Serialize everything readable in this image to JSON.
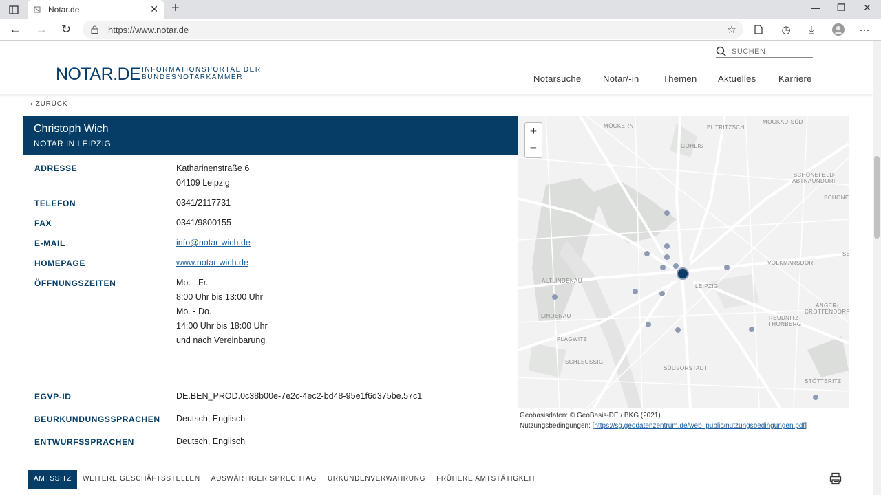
{
  "browser": {
    "tab_title": "Notar.de",
    "url": "https://www.notar.de"
  },
  "site": {
    "logo": "NOTAR.DE",
    "logo_sub_line1": "INFORMATIONSPORTAL DER",
    "logo_sub_line2": "BUNDESNOTARKAMMER",
    "search_placeholder": "SUCHEN",
    "nav": [
      "Notarsuche",
      "Notar/-in",
      "Themen",
      "Aktuelles",
      "Karriere"
    ],
    "back_label": "ZURÜCK"
  },
  "notary": {
    "name": "Christoph Wich",
    "role": "NOTAR IN LEIPZIG",
    "fields": {
      "address_label": "ADRESSE",
      "address_line1": "Katharinenstraße 6",
      "address_line2": "04109 Leipzig",
      "phone_label": "TELEFON",
      "phone": "0341/2117731",
      "fax_label": "FAX",
      "fax": "0341/9800155",
      "email_label": "E-MAIL",
      "email": "info@notar-wich.de",
      "homepage_label": "HOMEPAGE",
      "homepage": "www.notar-wich.de",
      "hours_label": "ÖFFNUNGSZEITEN",
      "hours": [
        "Mo. - Fr.",
        "8:00 Uhr bis 13:00 Uhr",
        "Mo. - Do.",
        "14:00 Uhr bis 18:00 Uhr",
        "und nach Vereinbarung"
      ],
      "egvp_label": "EGVP-ID",
      "egvp": "DE.BEN_PROD.0c38b00e-7e2c-4ec2-bd48-95e1f6d375be.57c1",
      "languages_label": "BEURKUNDUNGSSPRACHEN",
      "languages": "Deutsch, Englisch",
      "draft_languages_label": "ENTWURFSSPRACHEN",
      "draft_languages": "Deutsch, Englisch"
    }
  },
  "map": {
    "zoom_in": "+",
    "zoom_out": "−",
    "places": {
      "moeckern": "MÖCKERN",
      "eutritzsch": "EUTRITZSCH",
      "mockau": "MOCKAU-SÜD",
      "gohlis": "GOHLIS",
      "schoenefeld_1": "SCHÖNEFELD-",
      "schoenefeld_2": "ABTNAUNDORF",
      "schoene": "SCHÖNE",
      "volkmarsdorf": "VOLKMARSDORF",
      "se": "SE",
      "altlindenau": "ALTLINDENAU",
      "leipzig": "LEIPZIG",
      "lindenau": "LINDENAU",
      "anger_1": "ANGER-",
      "anger_2": "CROTTENDORF",
      "reudnitz_1": "REUDNITZ-",
      "reudnitz_2": "THONBERG",
      "plagwitz": "PLAGWITZ",
      "schleussig": "SCHLEUSSIG",
      "suedvorstadt": "SÜDVORSTADT",
      "stoetteritz": "STÖTTERITZ"
    },
    "attribution_line1": "Geobasisdaten: © GeoBasis-DE / BKG (2021)",
    "attribution_prefix": "Nutzungsbedingungen: [",
    "attribution_link": "https://sg.geodatenzentrum.de/web_public/nutzungsbedingungen.pdf",
    "attribution_suffix": "]"
  },
  "bottom_tabs": [
    "AMTSSITZ",
    "WEITERE GESCHÄFTSSTELLEN",
    "AUSWÄRTIGER SPRECHTAG",
    "URKUNDENVERWAHRUNG",
    "FRÜHERE AMTSTÄTIGKEIT"
  ],
  "colors": {
    "brand": "#053d66",
    "link": "#1d5f9e"
  }
}
